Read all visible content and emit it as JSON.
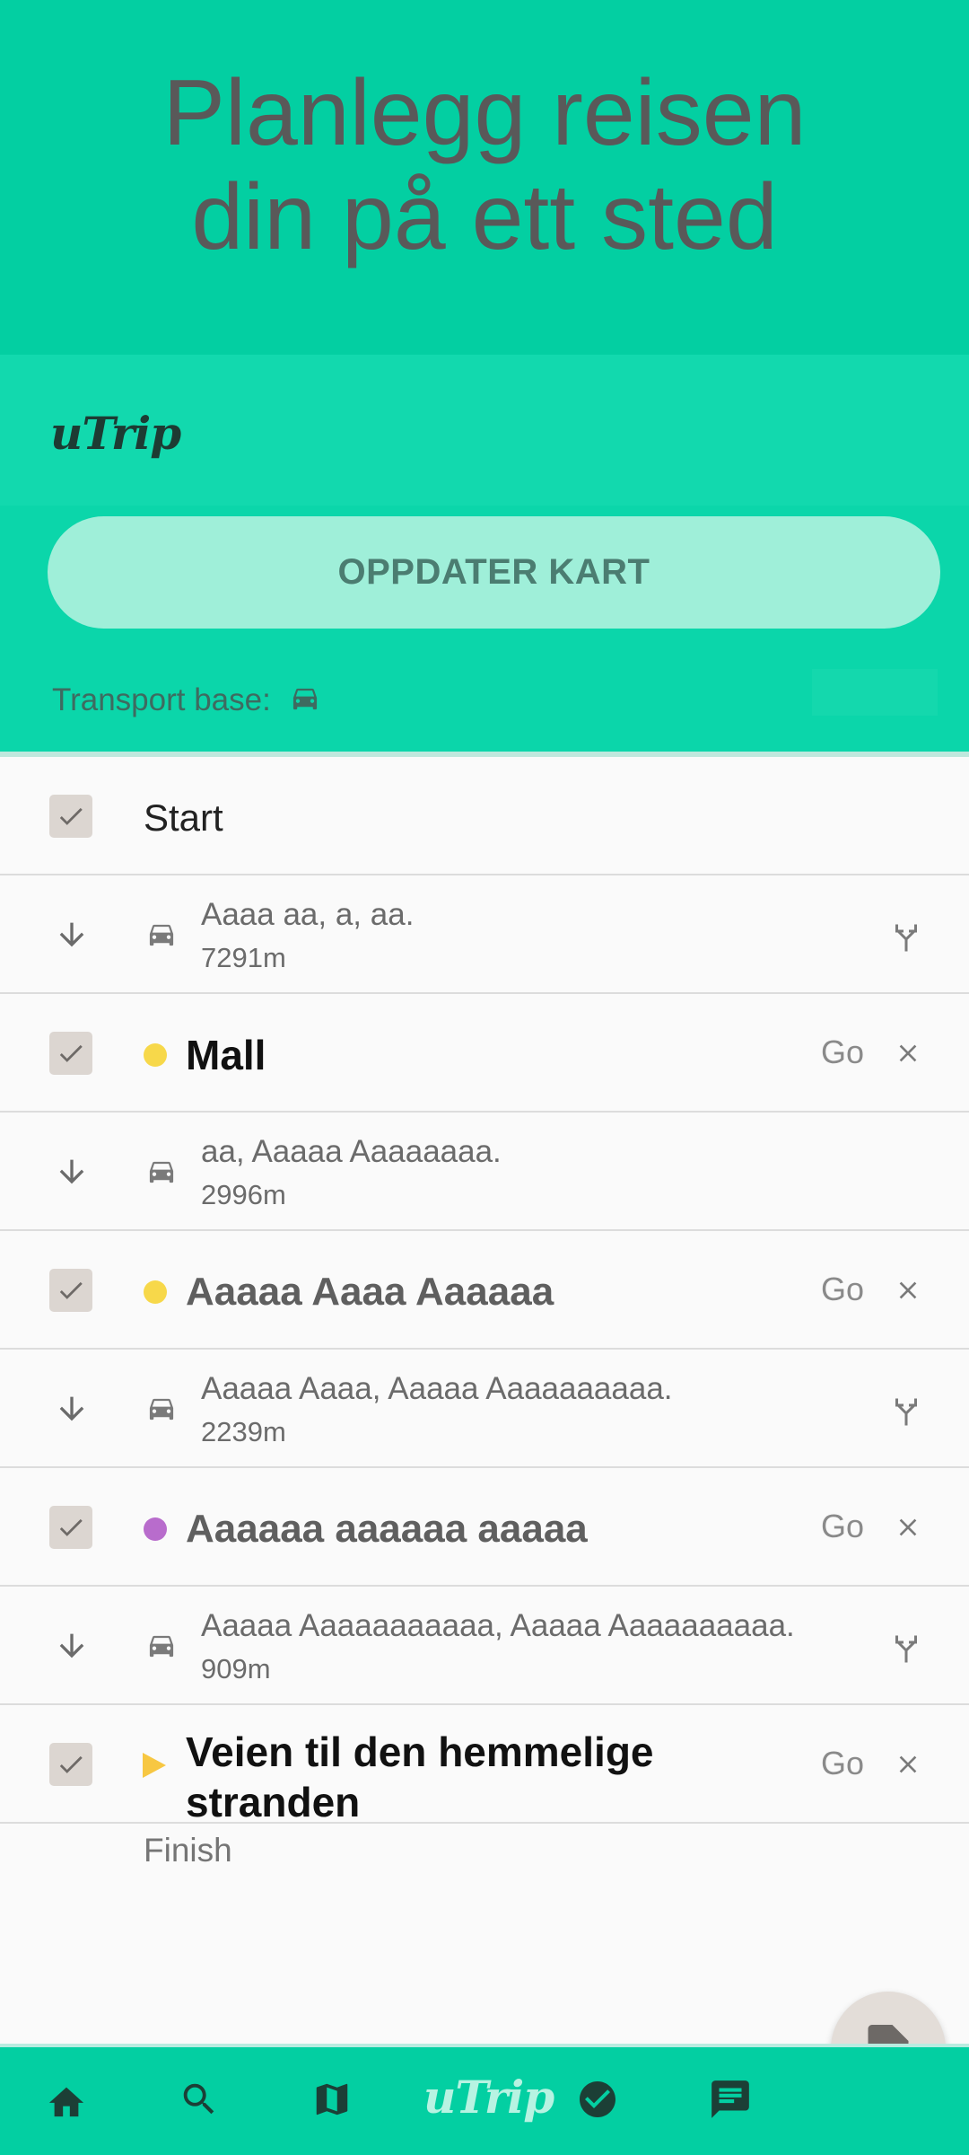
{
  "hero": {
    "title_line1": "Planlegg reisen",
    "title_line2": "din på ett sted"
  },
  "brand": {
    "logo_text": "uTrip"
  },
  "actions": {
    "update_map_label": "OPPDATER KART"
  },
  "transport": {
    "label": "Transport base:",
    "icon": "car-icon"
  },
  "colors": {
    "primary": "#03cfa2",
    "yellow": "#f7d84a",
    "purple": "#b86ccc",
    "triangle": "#f7c742"
  },
  "trip": {
    "start_label": "Start",
    "finish_label": "Finish",
    "go_label": "Go",
    "places": [
      {
        "name": "Mall",
        "marker": "yellow-dot"
      },
      {
        "name": "Aaaaa Aaaa Aaaaaa",
        "marker": "yellow-dot"
      },
      {
        "name": "Aaaaaa aaaaaa aaaaa",
        "marker": "purple-dot"
      },
      {
        "name_line1": "Veien til den hemmelige",
        "name_line2": "stranden",
        "marker": "yellow-triangle"
      }
    ],
    "legs": [
      {
        "text": "Aaaa aa, a, aa.",
        "distance": "7291m",
        "has_route_icon": true
      },
      {
        "text": "aa, Aaaaa Aaaaaaaa.",
        "distance": "2996m",
        "has_route_icon": false
      },
      {
        "text": "Aaaaa Aaaa, Aaaaa Aaaaaaaaaa.",
        "distance": "2239m",
        "has_route_icon": true
      },
      {
        "text": "Aaaaa Aaaaaaaaaaa, Aaaaa Aaaaaaaaaa.",
        "distance": "909m",
        "has_route_icon": true
      }
    ]
  },
  "bottom_nav": {
    "items": [
      "home-icon",
      "search-icon",
      "map-icon",
      "utrip-logo",
      "check-circle-icon",
      "chat-icon"
    ],
    "logo_text": "uTrip"
  },
  "fab": {
    "icon": "contact-document-icon"
  }
}
